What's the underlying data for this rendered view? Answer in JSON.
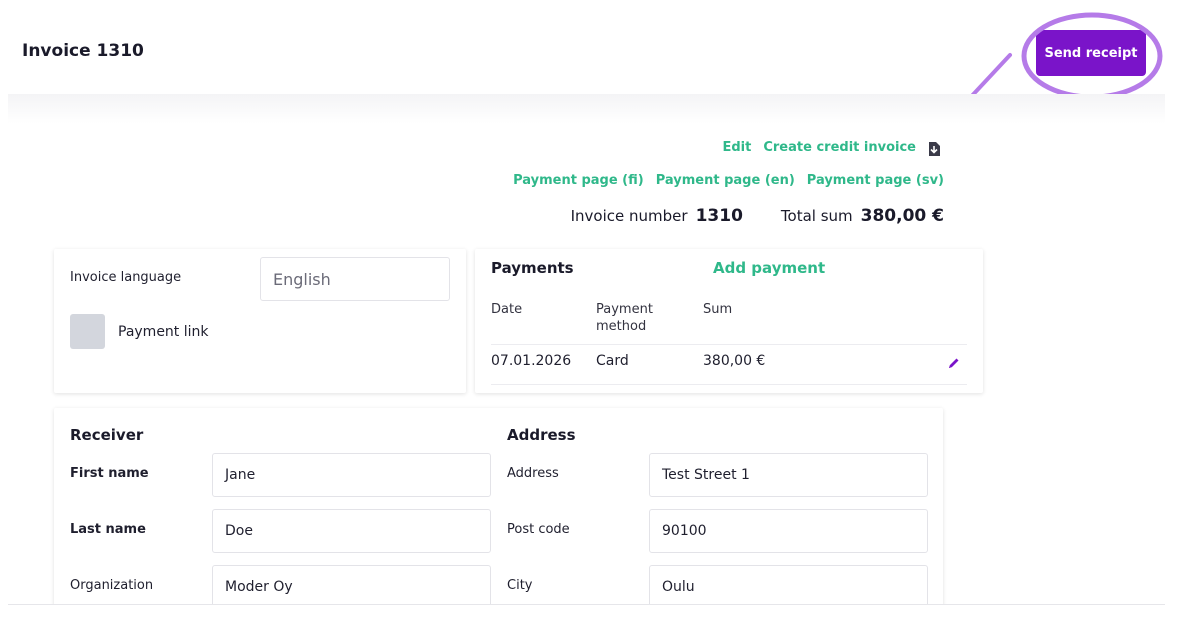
{
  "header": {
    "title": "Invoice 1310",
    "send_receipt": "Send receipt"
  },
  "links": {
    "edit": "Edit",
    "create_credit": "Create credit invoice",
    "payment_fi": "Payment page (fi)",
    "payment_en": "Payment page (en)",
    "payment_sv": "Payment page (sv)"
  },
  "summary": {
    "invoice_number_label": "Invoice number",
    "invoice_number": "1310",
    "total_label": "Total sum",
    "total": "380,00 €"
  },
  "language": {
    "label": "Invoice language",
    "value": "English",
    "payment_link_label": "Payment link"
  },
  "payments": {
    "title": "Payments",
    "add": "Add payment",
    "columns": [
      "Date",
      "Payment method",
      "Sum"
    ],
    "rows": [
      {
        "date": "07.01.2026",
        "method": "Card",
        "sum": "380,00 €"
      }
    ]
  },
  "receiver": {
    "title": "Receiver",
    "first_name_label": "First name",
    "first_name": "Jane",
    "last_name_label": "Last name",
    "last_name": "Doe",
    "organization_label": "Organization",
    "organization": "Moder Oy"
  },
  "address": {
    "title": "Address",
    "address_label": "Address",
    "address": "Test Street 1",
    "post_code_label": "Post code",
    "post_code": "90100",
    "city_label": "City",
    "city": "Oulu"
  },
  "colors": {
    "accent": "#7a14c9",
    "link": "#2fb88a",
    "annotation": "#b57be8"
  },
  "icons": [
    "download-icon",
    "pencil-icon",
    "annotation-arrow",
    "annotation-circle"
  ]
}
